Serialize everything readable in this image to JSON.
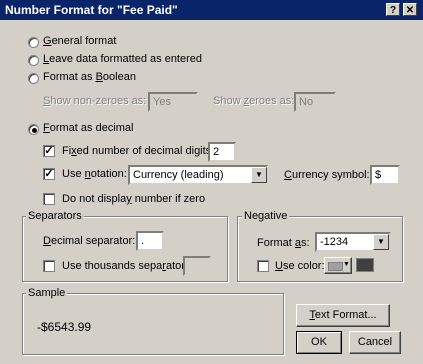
{
  "window": {
    "title": "Number Format for \"Fee Paid\"",
    "help_btn": "?",
    "close_btn": "✕"
  },
  "format_options": {
    "general": "General format",
    "leave": "Leave data formatted as entered",
    "boolean": "Format as Boolean",
    "decimal": "Format as decimal",
    "selected": "decimal"
  },
  "boolean_opts": {
    "show_nonzeroes_label": "Show non-zeroes as:",
    "show_nonzeroes_value": "Yes",
    "show_zeroes_label": "Show zeroes as:",
    "show_zeroes_value": "No"
  },
  "decimal_opts": {
    "fixed_digits_label": "Fixed number of decimal digits:",
    "fixed_digits_checked": true,
    "fixed_digits_value": "2",
    "use_notation_label": "Use notation:",
    "use_notation_checked": true,
    "notation_value": "Currency (leading)",
    "currency_symbol_label": "Currency symbol:",
    "currency_symbol_value": "$",
    "no_zero_label": "Do not display number if zero",
    "no_zero_checked": false
  },
  "separators": {
    "title": "Separators",
    "decimal_sep_label": "Decimal separator:",
    "decimal_sep_value": ".",
    "thousands_label": "Use thousands separator:",
    "thousands_checked": false,
    "thousands_value": ""
  },
  "negative": {
    "title": "Negative",
    "format_label": "Format as:",
    "format_value": "-1234",
    "use_color_label": "Use color:",
    "use_color_checked": false,
    "color_swatch": "#404040"
  },
  "sample": {
    "title": "Sample",
    "value": "-$6543.99"
  },
  "buttons": {
    "text_format": "Text Format...",
    "ok": "OK",
    "cancel": "Cancel"
  },
  "colors": {
    "titlebar": "#0a246a",
    "face": "#d4d0c8"
  }
}
